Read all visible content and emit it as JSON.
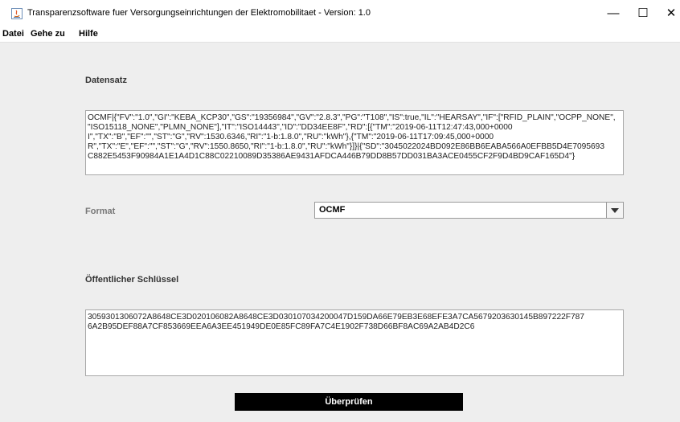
{
  "window": {
    "title": "Transparenzsoftware fuer Versorgungseinrichtungen der Elektromobilitaet - Version: 1.0",
    "minimize": "—",
    "maximize": "☐",
    "close": "✕"
  },
  "menu": [
    "Datei",
    "Gehe zu",
    "Hilfe"
  ],
  "datensatz": {
    "label": "Datensatz",
    "lines": [
      "OCMF|{\"FV\":\"1.0\",\"GI\":\"KEBA_KCP30\",\"GS\":\"19356984\",\"GV\":\"2.8.3\",\"PG\":\"T108\",\"IS\":true,\"IL\":\"HEARSAY\",\"IF\":[\"RFID_PLAIN\",\"OCPP_NONE\",",
      "\"ISO15118_NONE\",\"PLMN_NONE\"],\"IT\":\"ISO14443\",\"ID\":\"DD34EE8F\",\"RD\":[{\"TM\":\"2019-06-11T12:47:43,000+0000",
      "I\",\"TX\":\"B\",\"EF\":\"\",\"ST\":\"G\",\"RV\":1530.6346,\"RI\":\"1-b:1.8.0\",\"RU\":\"kWh\"},{\"TM\":\"2019-06-11T17:09:45,000+0000",
      "R\",\"TX\":\"E\",\"EF\":\"\",\"ST\":\"G\",\"RV\":1550.8650,\"RI\":\"1-b:1.8.0\",\"RU\":\"kWh\"}]}|{\"SD\":\"3045022024BD092E86BB6EABA566A0EFBB5D4E7095693",
      "C882E5453F90984A1E1A4D1C88C02210089D35386AE9431AFDCA446B79DD8B57DD031BA3ACE0455CF2F9D4BD9CAF165D4\"}"
    ]
  },
  "format": {
    "label": "Format",
    "selected": "OCMF"
  },
  "public_key": {
    "label": "Öffentlicher Schlüssel",
    "lines": [
      "3059301306072A8648CE3D020106082A8648CE3D030107034200047D159DA66E79EB3E68EFE3A7CA5679203630145B897222F787",
      "6A2B95DEF88A7CF853669EEA6A3EE451949DE0E85FC89FA7C4E1902F738D66BF8AC69A2AB4D2C6"
    ]
  },
  "verify_button": "Überprüfen",
  "colors": {
    "background": "#eeeeee",
    "button": "#000000",
    "button_text": "#ffffff"
  }
}
